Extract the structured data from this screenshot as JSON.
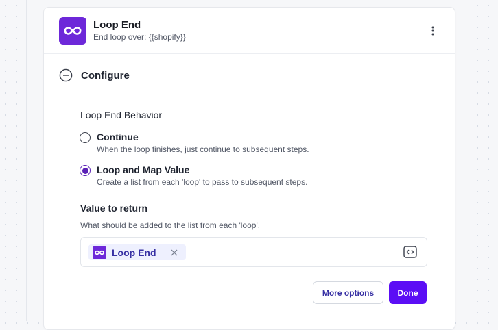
{
  "step": {
    "title": "Loop End",
    "subtitle": "End loop over: {{shopify}}",
    "icon": "infinity-icon",
    "accent_color": "#6d28d9"
  },
  "configure": {
    "label": "Configure",
    "icon": "collapse-circle-minus-icon"
  },
  "behavior": {
    "label": "Loop End Behavior",
    "options": [
      {
        "title": "Continue",
        "description": "When the loop finishes, just continue to subsequent steps.",
        "selected": false
      },
      {
        "title": "Loop and Map Value",
        "description": "Create a list from each 'loop' to pass to subsequent steps.",
        "selected": true
      }
    ]
  },
  "value_to_return": {
    "label": "Value to return",
    "help": "What should be added to the list from each 'loop'.",
    "chip_label": "Loop End",
    "chip_icon": "infinity-icon",
    "code_icon": "code-brackets-icon"
  },
  "actions": {
    "more_options": "More options",
    "done": "Done",
    "primary_color": "#5b0ef5"
  }
}
